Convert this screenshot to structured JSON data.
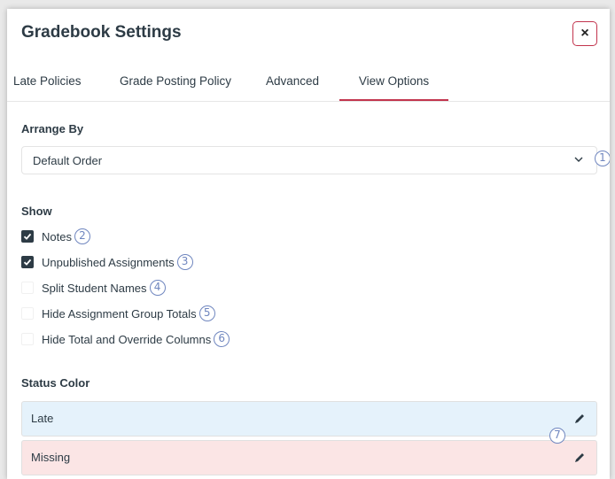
{
  "dialog": {
    "title": "Gradebook Settings",
    "close_label": "×"
  },
  "tabs": [
    {
      "label": "Late Policies",
      "active": false
    },
    {
      "label": "Grade Posting Policy",
      "active": false
    },
    {
      "label": "Advanced",
      "active": false
    },
    {
      "label": "View Options",
      "active": true
    }
  ],
  "arrange_by": {
    "label": "Arrange By",
    "selected": "Default Order",
    "callout": "1"
  },
  "show": {
    "label": "Show",
    "options": [
      {
        "label": "Notes",
        "checked": true,
        "callout": "2"
      },
      {
        "label": "Unpublished Assignments",
        "checked": true,
        "callout": "3"
      },
      {
        "label": "Split Student Names",
        "checked": false,
        "callout": "4"
      },
      {
        "label": "Hide Assignment Group Totals",
        "checked": false,
        "callout": "5"
      },
      {
        "label": "Hide Total and Override Columns",
        "checked": false,
        "callout": "6"
      }
    ]
  },
  "status_color": {
    "label": "Status Color",
    "callout": "7",
    "items": [
      {
        "label": "Late",
        "color": "#e5f2fb"
      },
      {
        "label": "Missing",
        "color": "#fbe5e5"
      }
    ]
  },
  "colors": {
    "accent": "#c2344d",
    "callout": "#6f86bf",
    "text": "#2d3b45"
  }
}
